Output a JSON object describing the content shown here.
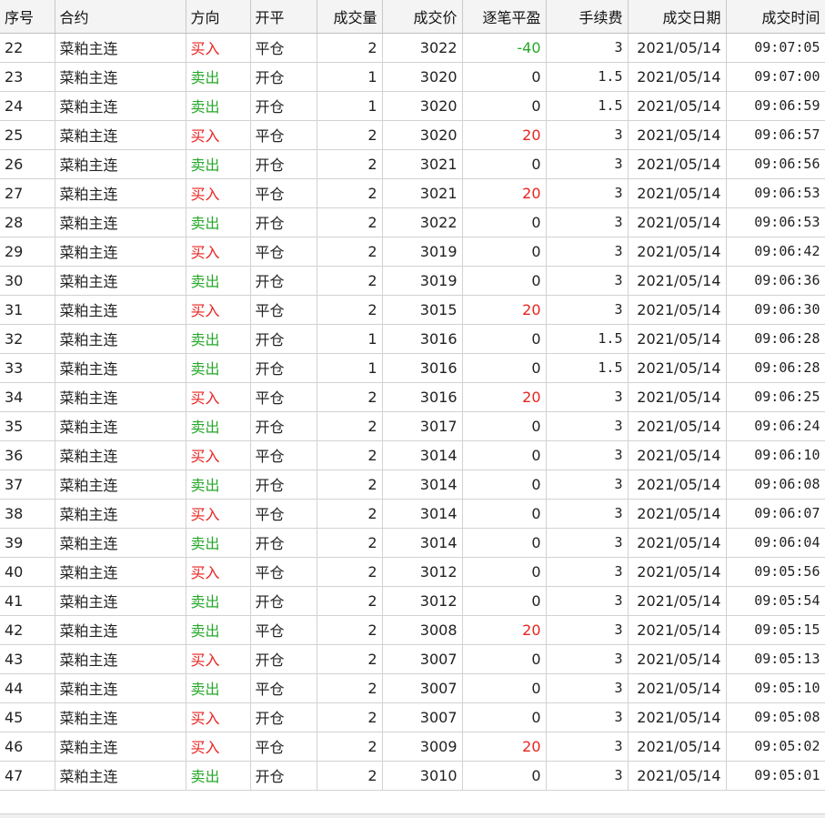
{
  "table": {
    "headers": [
      "序号",
      "合约",
      "方向",
      "开平",
      "成交量",
      "成交价",
      "逐笔平盈",
      "手续费",
      "成交日期",
      "成交时间"
    ],
    "colors": {
      "buy": "#e8231f",
      "sell": "#26a82a"
    },
    "rows": [
      {
        "idx": "22",
        "contract": "菜粕主连",
        "dir": "买入",
        "dir_type": "buy",
        "oc": "平仓",
        "vol": "2",
        "price": "3022",
        "pnl": "-40",
        "pnl_sign": "neg",
        "fee": "3",
        "date": "2021/05/14",
        "time": "09:07:05"
      },
      {
        "idx": "23",
        "contract": "菜粕主连",
        "dir": "卖出",
        "dir_type": "sell",
        "oc": "开仓",
        "vol": "1",
        "price": "3020",
        "pnl": "0",
        "pnl_sign": "zero",
        "fee": "1.5",
        "date": "2021/05/14",
        "time": "09:07:00"
      },
      {
        "idx": "24",
        "contract": "菜粕主连",
        "dir": "卖出",
        "dir_type": "sell",
        "oc": "开仓",
        "vol": "1",
        "price": "3020",
        "pnl": "0",
        "pnl_sign": "zero",
        "fee": "1.5",
        "date": "2021/05/14",
        "time": "09:06:59"
      },
      {
        "idx": "25",
        "contract": "菜粕主连",
        "dir": "买入",
        "dir_type": "buy",
        "oc": "平仓",
        "vol": "2",
        "price": "3020",
        "pnl": "20",
        "pnl_sign": "pos",
        "fee": "3",
        "date": "2021/05/14",
        "time": "09:06:57"
      },
      {
        "idx": "26",
        "contract": "菜粕主连",
        "dir": "卖出",
        "dir_type": "sell",
        "oc": "开仓",
        "vol": "2",
        "price": "3021",
        "pnl": "0",
        "pnl_sign": "zero",
        "fee": "3",
        "date": "2021/05/14",
        "time": "09:06:56"
      },
      {
        "idx": "27",
        "contract": "菜粕主连",
        "dir": "买入",
        "dir_type": "buy",
        "oc": "平仓",
        "vol": "2",
        "price": "3021",
        "pnl": "20",
        "pnl_sign": "pos",
        "fee": "3",
        "date": "2021/05/14",
        "time": "09:06:53"
      },
      {
        "idx": "28",
        "contract": "菜粕主连",
        "dir": "卖出",
        "dir_type": "sell",
        "oc": "开仓",
        "vol": "2",
        "price": "3022",
        "pnl": "0",
        "pnl_sign": "zero",
        "fee": "3",
        "date": "2021/05/14",
        "time": "09:06:53"
      },
      {
        "idx": "29",
        "contract": "菜粕主连",
        "dir": "买入",
        "dir_type": "buy",
        "oc": "平仓",
        "vol": "2",
        "price": "3019",
        "pnl": "0",
        "pnl_sign": "zero",
        "fee": "3",
        "date": "2021/05/14",
        "time": "09:06:42"
      },
      {
        "idx": "30",
        "contract": "菜粕主连",
        "dir": "卖出",
        "dir_type": "sell",
        "oc": "开仓",
        "vol": "2",
        "price": "3019",
        "pnl": "0",
        "pnl_sign": "zero",
        "fee": "3",
        "date": "2021/05/14",
        "time": "09:06:36"
      },
      {
        "idx": "31",
        "contract": "菜粕主连",
        "dir": "买入",
        "dir_type": "buy",
        "oc": "平仓",
        "vol": "2",
        "price": "3015",
        "pnl": "20",
        "pnl_sign": "pos",
        "fee": "3",
        "date": "2021/05/14",
        "time": "09:06:30"
      },
      {
        "idx": "32",
        "contract": "菜粕主连",
        "dir": "卖出",
        "dir_type": "sell",
        "oc": "开仓",
        "vol": "1",
        "price": "3016",
        "pnl": "0",
        "pnl_sign": "zero",
        "fee": "1.5",
        "date": "2021/05/14",
        "time": "09:06:28"
      },
      {
        "idx": "33",
        "contract": "菜粕主连",
        "dir": "卖出",
        "dir_type": "sell",
        "oc": "开仓",
        "vol": "1",
        "price": "3016",
        "pnl": "0",
        "pnl_sign": "zero",
        "fee": "1.5",
        "date": "2021/05/14",
        "time": "09:06:28"
      },
      {
        "idx": "34",
        "contract": "菜粕主连",
        "dir": "买入",
        "dir_type": "buy",
        "oc": "平仓",
        "vol": "2",
        "price": "3016",
        "pnl": "20",
        "pnl_sign": "pos",
        "fee": "3",
        "date": "2021/05/14",
        "time": "09:06:25"
      },
      {
        "idx": "35",
        "contract": "菜粕主连",
        "dir": "卖出",
        "dir_type": "sell",
        "oc": "开仓",
        "vol": "2",
        "price": "3017",
        "pnl": "0",
        "pnl_sign": "zero",
        "fee": "3",
        "date": "2021/05/14",
        "time": "09:06:24"
      },
      {
        "idx": "36",
        "contract": "菜粕主连",
        "dir": "买入",
        "dir_type": "buy",
        "oc": "平仓",
        "vol": "2",
        "price": "3014",
        "pnl": "0",
        "pnl_sign": "zero",
        "fee": "3",
        "date": "2021/05/14",
        "time": "09:06:10"
      },
      {
        "idx": "37",
        "contract": "菜粕主连",
        "dir": "卖出",
        "dir_type": "sell",
        "oc": "开仓",
        "vol": "2",
        "price": "3014",
        "pnl": "0",
        "pnl_sign": "zero",
        "fee": "3",
        "date": "2021/05/14",
        "time": "09:06:08"
      },
      {
        "idx": "38",
        "contract": "菜粕主连",
        "dir": "买入",
        "dir_type": "buy",
        "oc": "平仓",
        "vol": "2",
        "price": "3014",
        "pnl": "0",
        "pnl_sign": "zero",
        "fee": "3",
        "date": "2021/05/14",
        "time": "09:06:07"
      },
      {
        "idx": "39",
        "contract": "菜粕主连",
        "dir": "卖出",
        "dir_type": "sell",
        "oc": "开仓",
        "vol": "2",
        "price": "3014",
        "pnl": "0",
        "pnl_sign": "zero",
        "fee": "3",
        "date": "2021/05/14",
        "time": "09:06:04"
      },
      {
        "idx": "40",
        "contract": "菜粕主连",
        "dir": "买入",
        "dir_type": "buy",
        "oc": "平仓",
        "vol": "2",
        "price": "3012",
        "pnl": "0",
        "pnl_sign": "zero",
        "fee": "3",
        "date": "2021/05/14",
        "time": "09:05:56"
      },
      {
        "idx": "41",
        "contract": "菜粕主连",
        "dir": "卖出",
        "dir_type": "sell",
        "oc": "开仓",
        "vol": "2",
        "price": "3012",
        "pnl": "0",
        "pnl_sign": "zero",
        "fee": "3",
        "date": "2021/05/14",
        "time": "09:05:54"
      },
      {
        "idx": "42",
        "contract": "菜粕主连",
        "dir": "卖出",
        "dir_type": "sell",
        "oc": "平仓",
        "vol": "2",
        "price": "3008",
        "pnl": "20",
        "pnl_sign": "pos",
        "fee": "3",
        "date": "2021/05/14",
        "time": "09:05:15"
      },
      {
        "idx": "43",
        "contract": "菜粕主连",
        "dir": "买入",
        "dir_type": "buy",
        "oc": "开仓",
        "vol": "2",
        "price": "3007",
        "pnl": "0",
        "pnl_sign": "zero",
        "fee": "3",
        "date": "2021/05/14",
        "time": "09:05:13"
      },
      {
        "idx": "44",
        "contract": "菜粕主连",
        "dir": "卖出",
        "dir_type": "sell",
        "oc": "平仓",
        "vol": "2",
        "price": "3007",
        "pnl": "0",
        "pnl_sign": "zero",
        "fee": "3",
        "date": "2021/05/14",
        "time": "09:05:10"
      },
      {
        "idx": "45",
        "contract": "菜粕主连",
        "dir": "买入",
        "dir_type": "buy",
        "oc": "开仓",
        "vol": "2",
        "price": "3007",
        "pnl": "0",
        "pnl_sign": "zero",
        "fee": "3",
        "date": "2021/05/14",
        "time": "09:05:08"
      },
      {
        "idx": "46",
        "contract": "菜粕主连",
        "dir": "买入",
        "dir_type": "buy",
        "oc": "平仓",
        "vol": "2",
        "price": "3009",
        "pnl": "20",
        "pnl_sign": "pos",
        "fee": "3",
        "date": "2021/05/14",
        "time": "09:05:02"
      },
      {
        "idx": "47",
        "contract": "菜粕主连",
        "dir": "卖出",
        "dir_type": "sell",
        "oc": "开仓",
        "vol": "2",
        "price": "3010",
        "pnl": "0",
        "pnl_sign": "zero",
        "fee": "3",
        "date": "2021/05/14",
        "time": "09:05:01"
      }
    ]
  }
}
